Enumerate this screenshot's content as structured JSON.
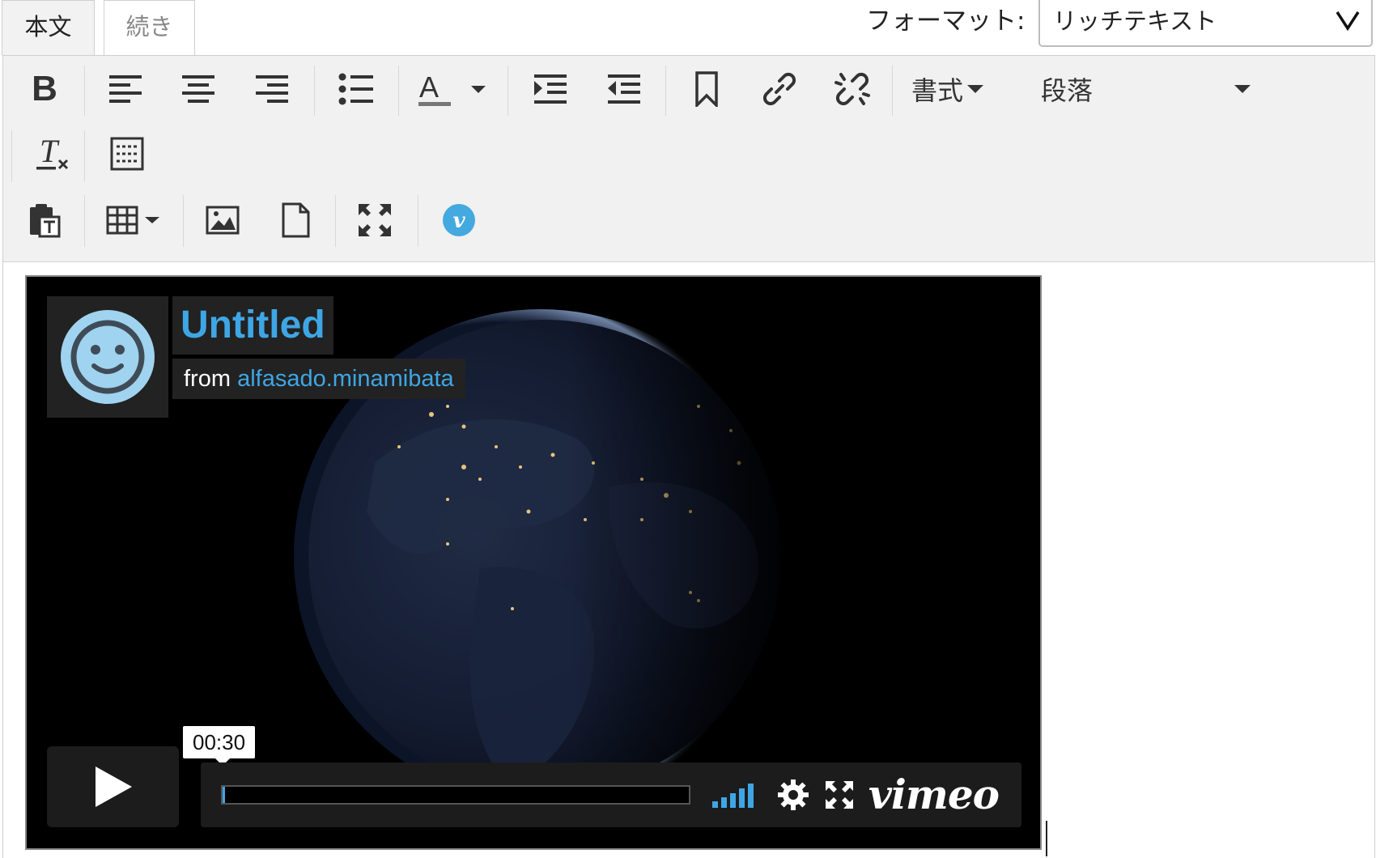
{
  "tabs": {
    "body": "本文",
    "continue": "続き"
  },
  "format": {
    "label": "フォーマット:",
    "value": "リッチテキスト"
  },
  "toolbar": {
    "styles_label": "書式",
    "paragraph_label": "段落",
    "icons": [
      "bold-icon",
      "align-left-icon",
      "align-center-icon",
      "align-right-icon",
      "bulleted-list-icon",
      "text-color-icon",
      "indent-icon",
      "outdent-icon",
      "anchor-icon",
      "link-icon",
      "unlink-icon",
      "remove-format-icon",
      "show-blocks-icon",
      "paste-text-icon",
      "table-icon",
      "image-icon",
      "document-icon",
      "maximize-icon",
      "vimeo-icon"
    ]
  },
  "video": {
    "title": "Untitled",
    "from": "from",
    "author": "alfasado.minamibata",
    "timecode": "00:30",
    "brand": "vimeo",
    "progress": 0.005,
    "accent": "#3ea6e5"
  }
}
